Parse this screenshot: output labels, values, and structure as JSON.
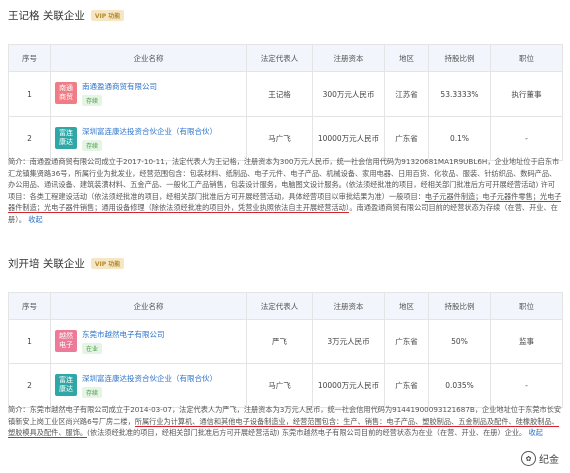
{
  "colors": {
    "link": "#2b73c9",
    "underline": "#d4232b",
    "header_bg": "#f2f5fb",
    "status_green": "#3d9a3d"
  },
  "columns": [
    "序号",
    "企业名称",
    "法定代表人",
    "注册资本",
    "地区",
    "持股比例",
    "职位"
  ],
  "section1": {
    "title": "王记格 关联企业",
    "vip": "VIP 功能",
    "rows": [
      {
        "index": "1",
        "logo": "南通\n商贸",
        "name": "南通盈通商贸有限公司",
        "status": "存续",
        "rep": "王记格",
        "capital": "300万元人民币",
        "region": "江苏省",
        "share": "53.3333%",
        "position": "执行董事"
      },
      {
        "index": "2",
        "logo": "富连\n康达",
        "name": "深圳富连康达投资合伙企业（有限合伙）",
        "status": "存续",
        "rep": "马广飞",
        "capital": "10000万元人民币",
        "region": "广东省",
        "share": "0.1%",
        "position": "-"
      }
    ],
    "desc_part1": "简介：南通盈通商贸有限公司成立于2017-10-11，法定代表人为王记格，注册资本为300万元人民币，统一社会信用代码为91320681MA1R9UBL6H，企业地址位于启东市汇龙镇集贤路36号，所属行业为批发业，经营范围包含：包装材料、纸制品、电子元件、电子产品、机械设备、家用电器、日用百货、化妆品、服装、针纺织品、数码产品、办公用品、通讯设备、建筑装潢材料、五金产品、一般化工产品销售，包装设计服务，电脑图文设计服务。(依法须经批准的项目，经相关部门批准后方可开展经营活动) 许可项目：各类工程建设活动（依法须经批准的项目，经相关部门批准后方可开展经营活动，具体经营项目以审批结果为准）一般项目：",
    "desc_underlined": "电子元器件制造；电子元器件零售；光电子器件制造；光电子器件销售；通用设备修理（除依法须经批准的项目外，凭营业执照依法自主开展经营活动）",
    "desc_part2": "。南通盈通商贸有限公司目前的经营状态为存续（在营、开业、在册）。",
    "collapse": "收起"
  },
  "section2": {
    "title": "刘开培 关联企业",
    "vip": "VIP 功能",
    "rows": [
      {
        "index": "1",
        "logo": "越然\n电子",
        "name": "东莞市越然电子有限公司",
        "status": "在业",
        "rep": "严飞",
        "capital": "3万元人民币",
        "region": "广东省",
        "share": "50%",
        "position": "监事"
      },
      {
        "index": "2",
        "logo": "富连\n康达",
        "name": "深圳富连康达投资合伙企业（有限合伙）",
        "status": "存续",
        "rep": "马广飞",
        "capital": "10000万元人民币",
        "region": "广东省",
        "share": "0.035%",
        "position": "-"
      }
    ],
    "desc_part1": "简介：东莞市越然电子有限公司成立于2014-03-07，法定代表人为严飞，注册资本为3万元人民币，统一社会信用代码为91441900093121687B，企业地址位于东莞市长安镇新安上岗工业区尚兴路6号厂房二楼，",
    "desc_underlined": "所属行业为计算机、通信和其他电子设备制造业，经营范围包含：生产、销售：电子产品、塑胶制品、五金制品及配件、硅橡胶制品、塑胶模具及配件、服饰。",
    "desc_part2": "(依法须经批准的项目，经相关部门批准后方可开展经营活动) 东莞市越然电子有限公司目前的经营状态为在业（在营、开业、在册）企业。",
    "collapse": "收起"
  },
  "watermark": "纪金"
}
